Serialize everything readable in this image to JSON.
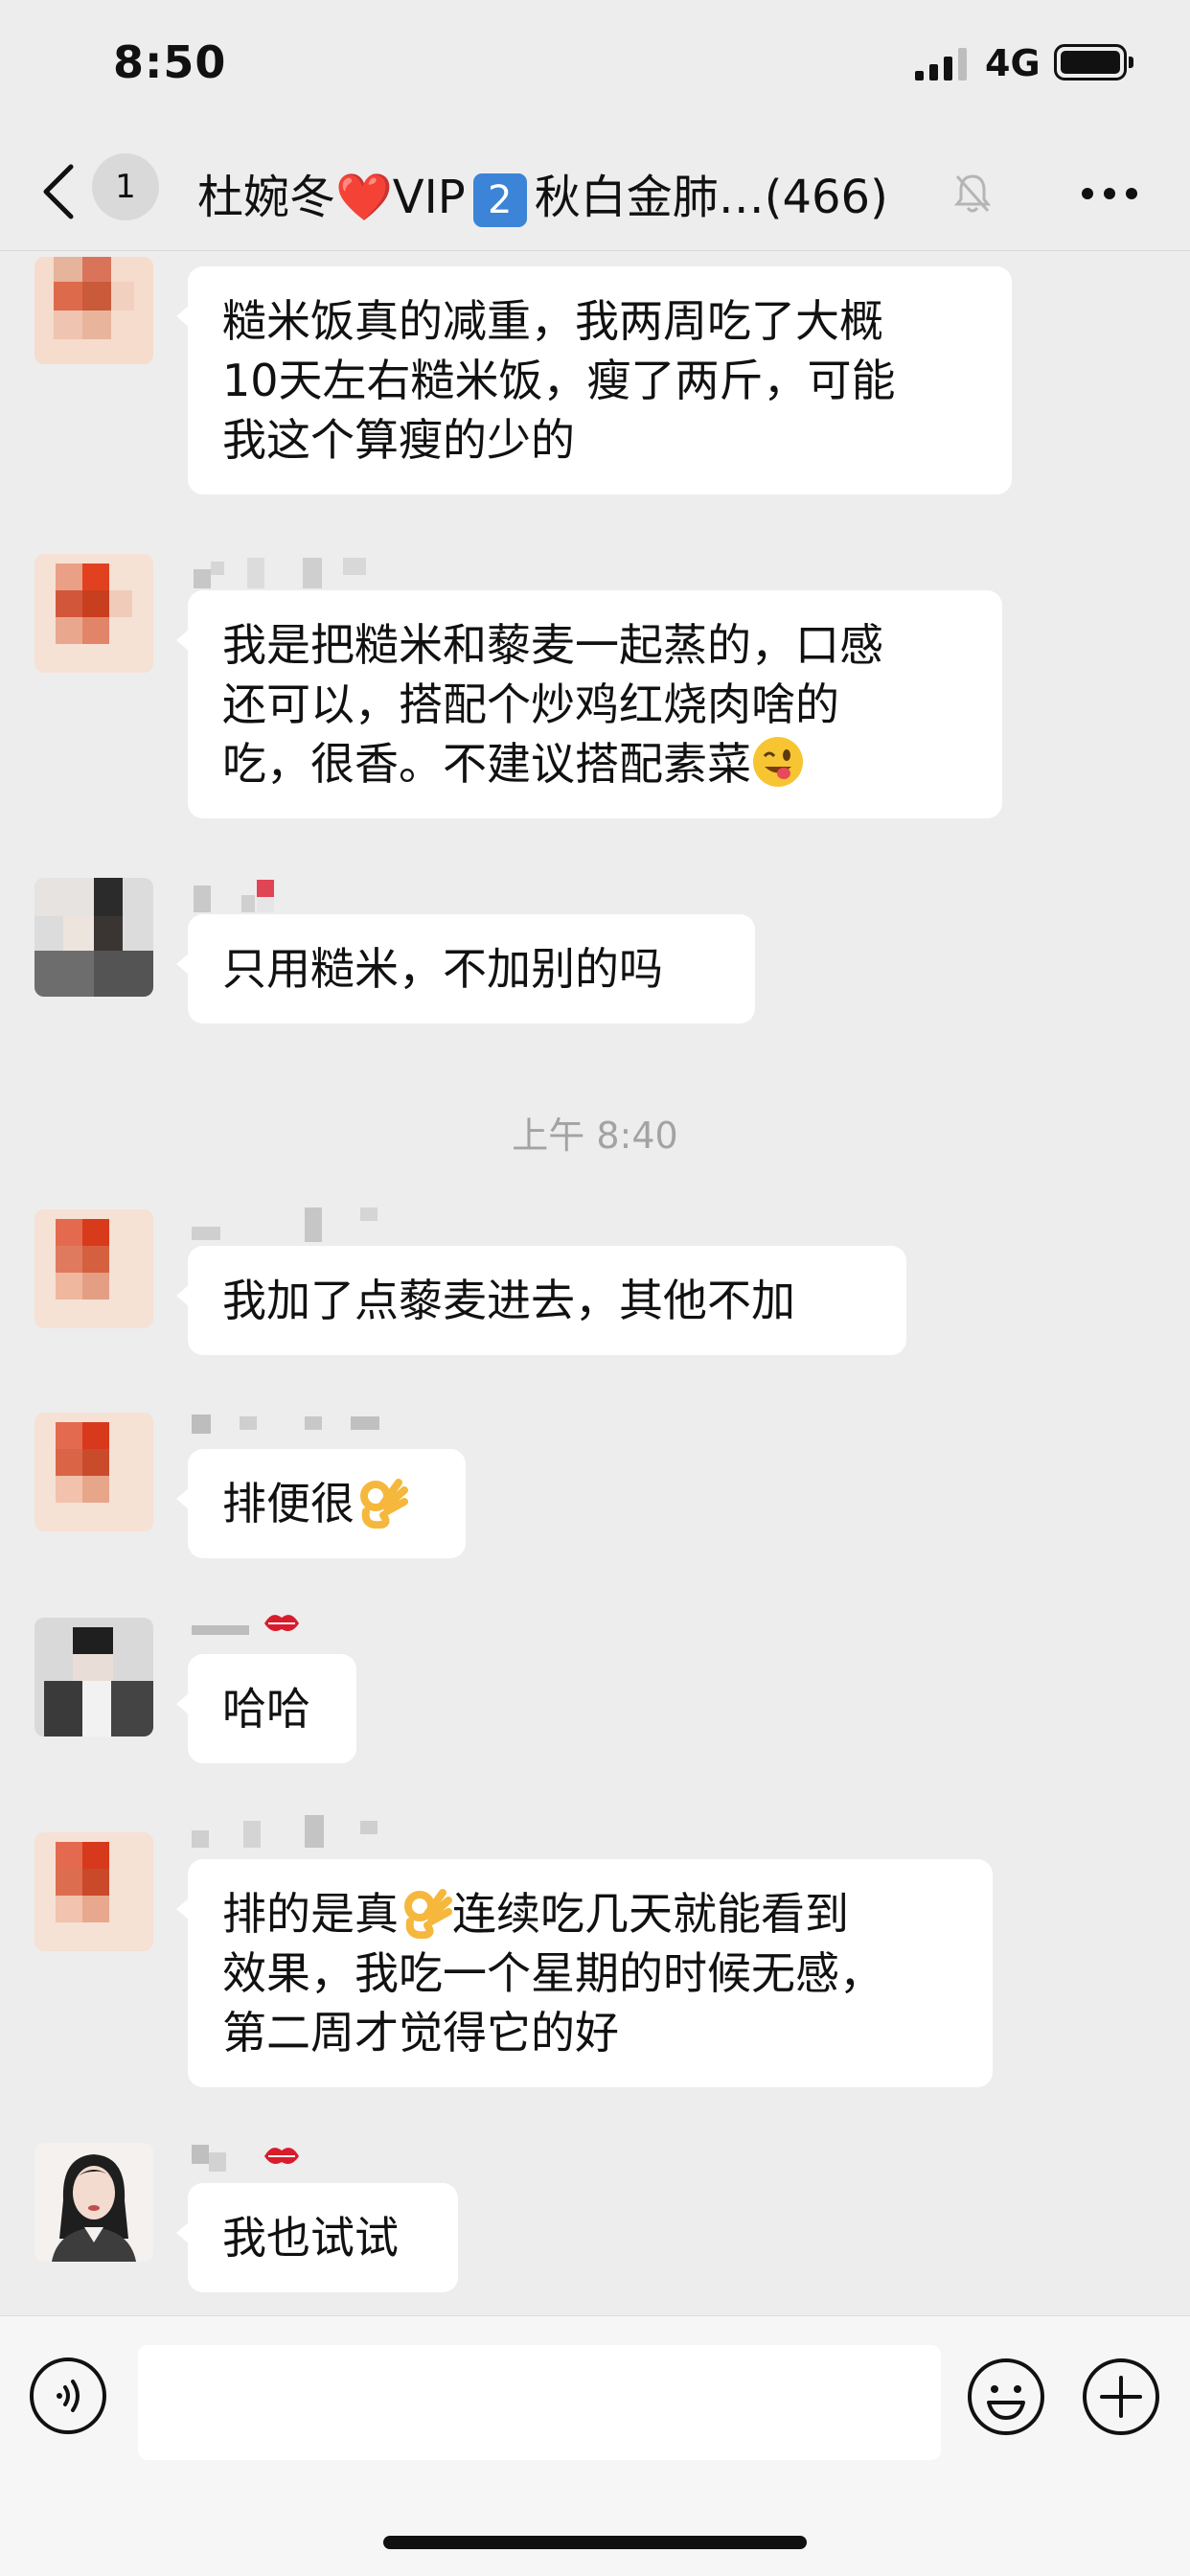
{
  "status_bar": {
    "time": "8:50",
    "network": "4G"
  },
  "nav": {
    "unread_count": "1",
    "title_prefix": "杜婉冬",
    "title_heart": "❤️",
    "title_vip": "VIP",
    "title_num": "2",
    "title_suffix": "秋白金肺…(466)"
  },
  "timestamp": "上午 8:40",
  "messages": [
    {
      "sender": "pixelated-avatar-1",
      "text": "糙米饭真的减重，我两周吃了大概\n10天左右糙米饭，瘦了两斤，可能\n我这个算瘦的少的"
    },
    {
      "sender": "pixelated-avatar-1",
      "text": "我是把糙米和藜麦一起蒸的，口感\n还可以，搭配个炒鸡红烧肉啥的\n吃，很香。不建议搭配素菜",
      "emoji": "winking-tongue-emoji"
    },
    {
      "sender": "pixelated-avatar-2",
      "text": "只用糙米，不加别的吗"
    },
    {
      "sender": "pixelated-avatar-1",
      "text": "我加了点藜麦进去，其他不加"
    },
    {
      "sender": "pixelated-avatar-1",
      "text": "排便很",
      "emoji": "ok-hand-emoji"
    },
    {
      "sender": "pixelated-avatar-3",
      "text": "哈哈"
    },
    {
      "sender": "pixelated-avatar-1",
      "text_a": "排的是真",
      "text_b": "连续吃几天就能看到\n效果，我吃一个星期的时候无感，\n第二周才觉得它的好",
      "emoji": "ok-hand-emoji"
    },
    {
      "sender": "pixelated-avatar-4",
      "text": "我也试试"
    }
  ],
  "input": {
    "placeholder": ""
  },
  "colors": {
    "background": "#ededed",
    "bubble": "#ffffff",
    "vip_badge": "#3b84d7",
    "heart": "#e0202e",
    "timestamp": "#a3a3a3"
  }
}
